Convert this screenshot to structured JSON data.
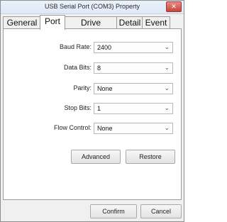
{
  "window": {
    "title": "USB Serial Port (COM3) Property",
    "close_glyph": "✕"
  },
  "tabs": [
    {
      "label": "General",
      "active": false
    },
    {
      "label": "Port",
      "active": true
    },
    {
      "label": "Drive Program",
      "active": false
    },
    {
      "label": "Detail",
      "active": false
    },
    {
      "label": "Event",
      "active": false
    }
  ],
  "settings": [
    {
      "label": "Baud Rate:",
      "value": "2400"
    },
    {
      "label": "Data Bits:",
      "value": "8"
    },
    {
      "label": "Parity:",
      "value": "None"
    },
    {
      "label": "Stop Bits:",
      "value": "1"
    },
    {
      "label": "Flow Control:",
      "value": "None"
    }
  ],
  "panel_buttons": {
    "advanced": "Advanced",
    "restore": "Restore"
  },
  "footer_buttons": {
    "confirm": "Confirm",
    "cancel": "Cancel"
  },
  "icons": {
    "dropdown": "chevron-down-icon",
    "close": "close-icon"
  }
}
